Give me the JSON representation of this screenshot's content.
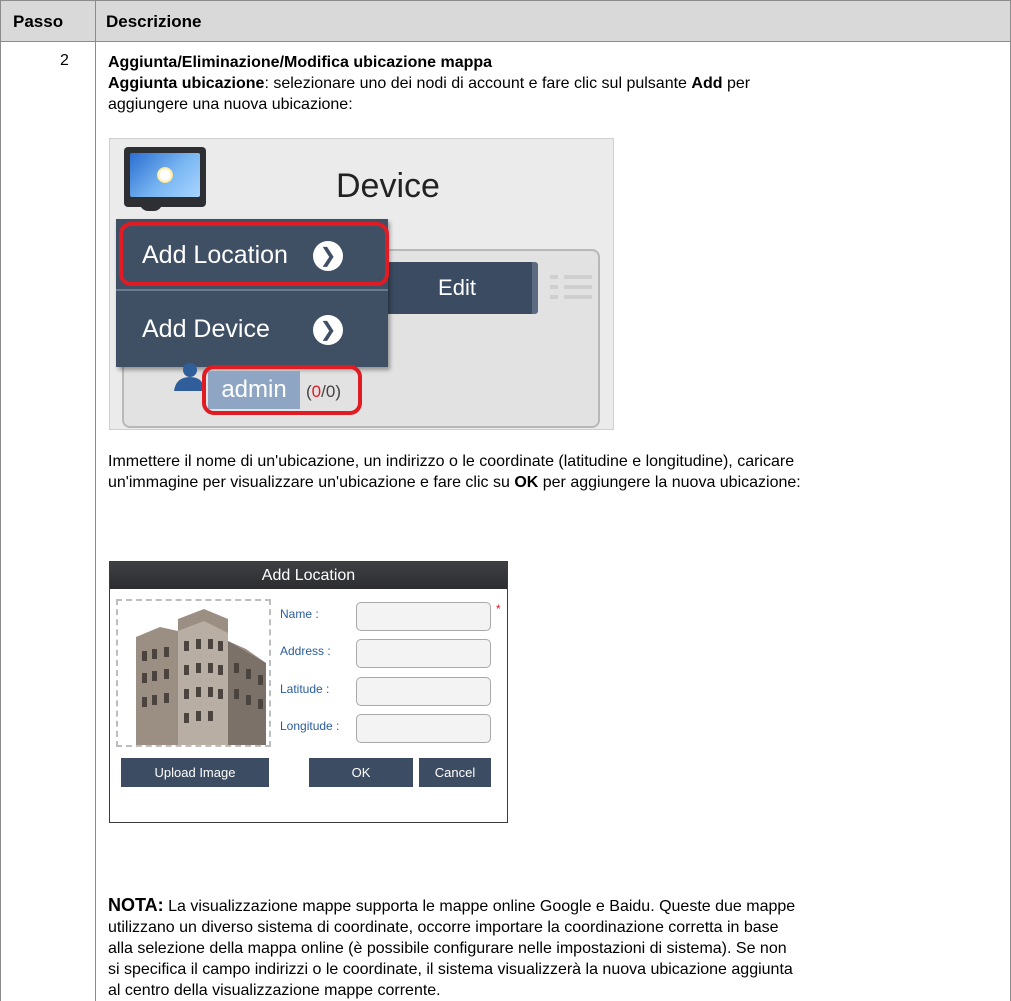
{
  "header": {
    "col_step": "Passo",
    "col_desc": "Descrizione"
  },
  "step": {
    "number": "2",
    "title": "Aggiunta/Eliminazione/Modifica ubicazione mappa",
    "add_label": "Aggiunta ubicazione",
    "add_text_1": ": selezionare uno dei nodi di account e fare clic sul pulsante ",
    "add_button_name": "Add",
    "add_text_2": " per",
    "add_text_3": "aggiungere una nuova ubicazione:",
    "enter_text_1": "Immettere il nome di un'ubicazione, un indirizzo o le coordinate (latitudine e longitudine), caricare",
    "enter_text_2a": "un'immagine per visualizzare un'ubicazione e fare clic su ",
    "enter_ok": "OK",
    "enter_text_2b": " per aggiungere la nuova ubicazione:",
    "note_label": "NOTA:",
    "note_lines": [
      " La visualizzazione mappe supporta le mappe online Google e Baidu. Queste due mappe",
      "utilizzano un diverso sistema di coordinate, occorre importare la coordinazione corretta in base",
      "alla selezione della mappa online (è possibile configurare nelle impostazioni di sistema). Se non",
      "si specifica il campo indirizzi o le coordinate, il sistema visualizzerà la nuova ubicazione aggiunta",
      "al centro della visualizzazione mappe corrente."
    ]
  },
  "screenshot1": {
    "device_title": "Device",
    "menu_add_location": "Add Location",
    "menu_add_device": "Add Device",
    "edit_button": "Edit",
    "user_name": "admin",
    "count_open": "(",
    "count_value": "0",
    "count_rest": "/0)",
    "chevron_glyph": "❯"
  },
  "screenshot2": {
    "dialog_title": "Add Location",
    "label_name": "Name :",
    "label_address": "Address :",
    "label_latitude": "Latitude :",
    "label_longitude": "Longitude :",
    "required_mark": "*",
    "btn_upload": "Upload Image",
    "btn_ok": "OK",
    "btn_cancel": "Cancel"
  }
}
